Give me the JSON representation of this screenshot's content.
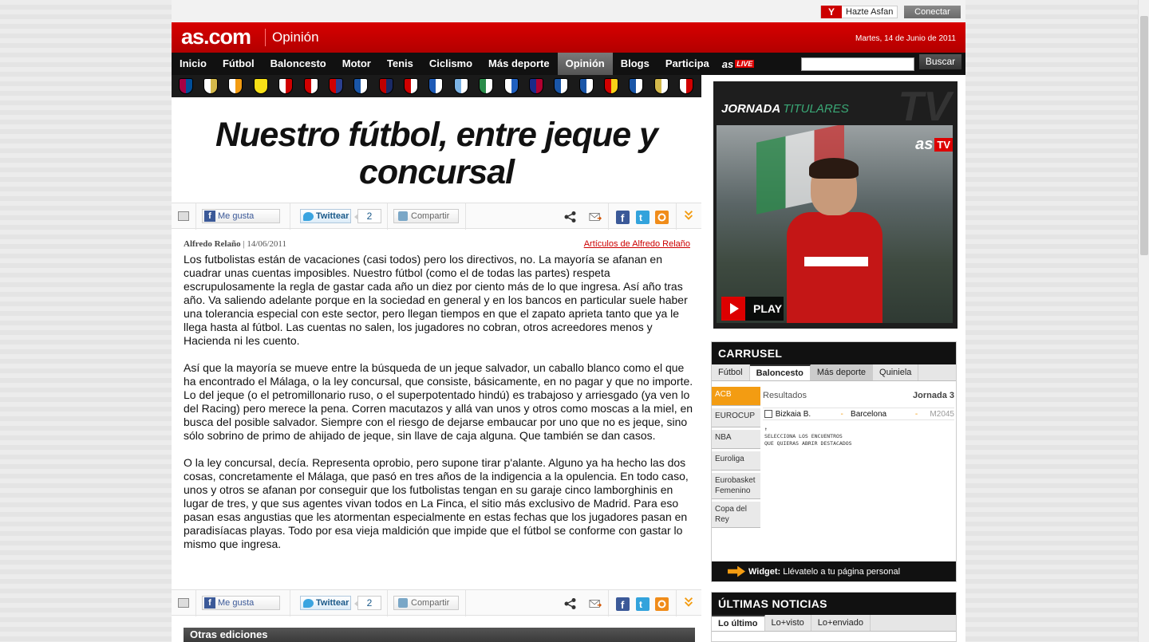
{
  "topbar": {
    "hazte_label": "Hazte Asfan",
    "conectar_label": "Conectar"
  },
  "header": {
    "logo": "as.com",
    "section": "Opinión",
    "date": "Martes, 14 de Junio de 2011"
  },
  "nav": {
    "items": [
      "Inicio",
      "Fútbol",
      "Baloncesto",
      "Motor",
      "Tenis",
      "Ciclismo",
      "Más deporte",
      "Opinión",
      "Blogs",
      "Participa"
    ],
    "active": "Opinión",
    "live_as": "as",
    "live_label": "LIVE",
    "search_button": "Buscar",
    "search_value": ""
  },
  "crests": [
    {
      "name": "barcelona",
      "c1": "#a50044",
      "c2": "#004d98"
    },
    {
      "name": "real-madrid",
      "c1": "#ffffff",
      "c2": "#d4b94b"
    },
    {
      "name": "valencia",
      "c1": "#ffffff",
      "c2": "#f39c12"
    },
    {
      "name": "villarreal",
      "c1": "#f7e017",
      "c2": "#f7e017"
    },
    {
      "name": "sevilla",
      "c1": "#ffffff",
      "c2": "#d00000"
    },
    {
      "name": "athletic",
      "c1": "#d00000",
      "c2": "#ffffff"
    },
    {
      "name": "atletico",
      "c1": "#d00000",
      "c2": "#2a3f8f"
    },
    {
      "name": "espanyol",
      "c1": "#1a56a8",
      "c2": "#ffffff"
    },
    {
      "name": "osasuna",
      "c1": "#c00000",
      "c2": "#1a2a66"
    },
    {
      "name": "sporting",
      "c1": "#d00000",
      "c2": "#ffffff"
    },
    {
      "name": "getafe",
      "c1": "#1e5bb7",
      "c2": "#ffffff"
    },
    {
      "name": "malaga",
      "c1": "#7cb4e6",
      "c2": "#ffffff"
    },
    {
      "name": "racing",
      "c1": "#2a8c4a",
      "c2": "#ffffff"
    },
    {
      "name": "zaragoza",
      "c1": "#ffffff",
      "c2": "#2060c0"
    },
    {
      "name": "levante",
      "c1": "#1a2a88",
      "c2": "#b00030"
    },
    {
      "name": "real-sociedad",
      "c1": "#1a56a8",
      "c2": "#ffffff"
    },
    {
      "name": "deportivo",
      "c1": "#1a56a8",
      "c2": "#ffffff"
    },
    {
      "name": "mallorca",
      "c1": "#d00000",
      "c2": "#f7d117"
    },
    {
      "name": "hercules",
      "c1": "#1a56a8",
      "c2": "#ffffff"
    },
    {
      "name": "almeria",
      "c1": "#d4b94b",
      "c2": "#ffffff"
    },
    {
      "name": "rayo",
      "c1": "#ffffff",
      "c2": "#d00000"
    }
  ],
  "article": {
    "headline": "Nuestro fútbol, entre jeque y concursal",
    "share": {
      "like_label": "Me gusta",
      "tweet_label": "Twittear",
      "tweet_count": "2",
      "compartir_label": "Compartir"
    },
    "author": "Alfredo Relaño",
    "date": "14/06/2011",
    "author_link": "Artículos de Alfredo Relaño",
    "paragraphs": [
      "Los futbolistas están de vacaciones (casi todos) pero los directivos, no. La mayoría se afanan en cuadrar unas cuentas imposibles. Nuestro fútbol (como el de todas las partes) respeta escrupulosamente la regla de gastar cada año un diez por ciento más de lo que ingresa. Así año tras año. Va saliendo adelante porque en la sociedad en general y en los bancos en particular suele haber una tolerancia especial con este sector, pero llegan tiempos en que el zapato aprieta tanto que ya le llega hasta al fútbol. Las cuentas no salen, los jugadores no cobran, otros acreedores menos y Hacienda ni les cuento.",
      "Así que la mayoría se mueve entre la búsqueda de un jeque salvador, un caballo blanco como el que ha encontrado el Málaga, o la ley concursal, que consiste, básicamente, en no pagar y que no importe. Lo del jeque (o el petromillonario ruso, o el superpotentado hindú) es trabajoso y arriesgado (ya ven lo del Racing) pero merece la pena. Corren macutazos y allá van unos y otros como moscas a la miel, en busca del posible salvador. Siempre con el riesgo de dejarse embaucar por uno que no es jeque, sino sólo sobrino de primo de ahijado de jeque, sin llave de caja alguna. Que también se dan casos.",
      "O la ley concursal, decía. Representa oprobio, pero supone tirar p'alante. Alguno ya ha hecho las dos cosas, concretamente el Málaga, que pasó en tres años de la indigencia a la opulencia. En todo caso, unos y otros se afanan por conseguir que los futbolistas tengan en su garaje cinco lamborghinis en lugar de tres, y que sus agentes vivan todos en La Finca, el sitio más exclusivo de Madrid. Para eso pasan esas angustias que les atormentan especialmente en estas fechas que los jugadores pasan en paradisíacas playas. Todo por esa vieja maldición que impide que el fútbol se conforme con gastar lo mismo que ingresa."
    ],
    "otras_ediciones": "Otras ediciones"
  },
  "video": {
    "title_main": "JORNADA",
    "title_sub": "TITULARES",
    "tv_watermark": "TV",
    "badge_as": "as",
    "badge_tv": "TV",
    "play_label": "PLAY"
  },
  "carrusel": {
    "title": "CARRUSEL",
    "tabs": [
      "Fútbol",
      "Baloncesto",
      "Más deporte",
      "Quiniela"
    ],
    "active_tab": "Baloncesto",
    "sports": [
      "ACB",
      "EUROCUP",
      "NBA",
      "Euroliga",
      "Eurobasket Femenino",
      "Copa del Rey"
    ],
    "active_sport": "ACB",
    "results_label": "Resultados",
    "jornada": "Jornada 3",
    "match": {
      "home": "Bizkaia B.",
      "sep": "-",
      "away": "Barcelona",
      "code": "M2045"
    },
    "hint_arrow": "↑",
    "hint_line1": "SELECCIONA LOS ENCUENTROS",
    "hint_line2": "QUE QUIERAS ABRIR DESTACADOS",
    "widget_bold": "Widget:",
    "widget_text": "Llévatelo a tu página personal"
  },
  "ultimas": {
    "title": "ÚLTIMAS NOTICIAS",
    "tabs": [
      "Lo último",
      "Lo+visto",
      "Lo+enviado"
    ],
    "active_tab": "Lo último"
  }
}
